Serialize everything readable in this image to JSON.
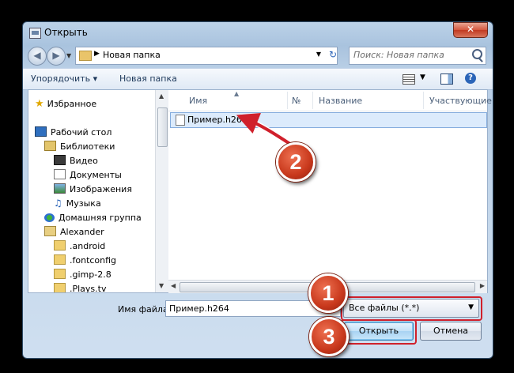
{
  "window": {
    "title": "Открыть",
    "close_label": "✕"
  },
  "address": {
    "path": "Новая папка",
    "search_placeholder": "Поиск: Новая папка"
  },
  "toolbar": {
    "organize_label": "Упорядочить ▾",
    "new_folder_label": "Новая папка"
  },
  "sidebar": {
    "items": [
      {
        "label": "Избранное",
        "icon": "star-icon"
      },
      {
        "label": "Рабочий стол",
        "icon": "desktop-icon"
      },
      {
        "label": "Библиотеки",
        "icon": "library-icon"
      },
      {
        "label": "Видео",
        "icon": "video-icon"
      },
      {
        "label": "Документы",
        "icon": "document-icon"
      },
      {
        "label": "Изображения",
        "icon": "image-icon"
      },
      {
        "label": "Музыка",
        "icon": "music-icon"
      },
      {
        "label": "Домашняя группа",
        "icon": "homegroup-icon"
      },
      {
        "label": "Alexander",
        "icon": "user-folder-icon"
      },
      {
        "label": ".android",
        "icon": "folder-icon"
      },
      {
        "label": ".fontconfig",
        "icon": "folder-icon"
      },
      {
        "label": ".gimp-2.8",
        "icon": "folder-icon"
      },
      {
        "label": ".Plays.tv",
        "icon": "folder-icon"
      }
    ]
  },
  "columns": {
    "name": "Имя",
    "number": "№",
    "title": "Название",
    "artists": "Участвующие ис..."
  },
  "files": [
    {
      "name": "Пример.h264"
    }
  ],
  "footer": {
    "filename_label": "Имя файла:",
    "filename_value": "Пример.h264",
    "filetype_value": "Все файлы (*.*)",
    "open_label": "Открыть",
    "cancel_label": "Отмена"
  },
  "annotations": {
    "badge_1": "1",
    "badge_2": "2",
    "badge_3": "3",
    "accent_color": "#d0202b"
  }
}
